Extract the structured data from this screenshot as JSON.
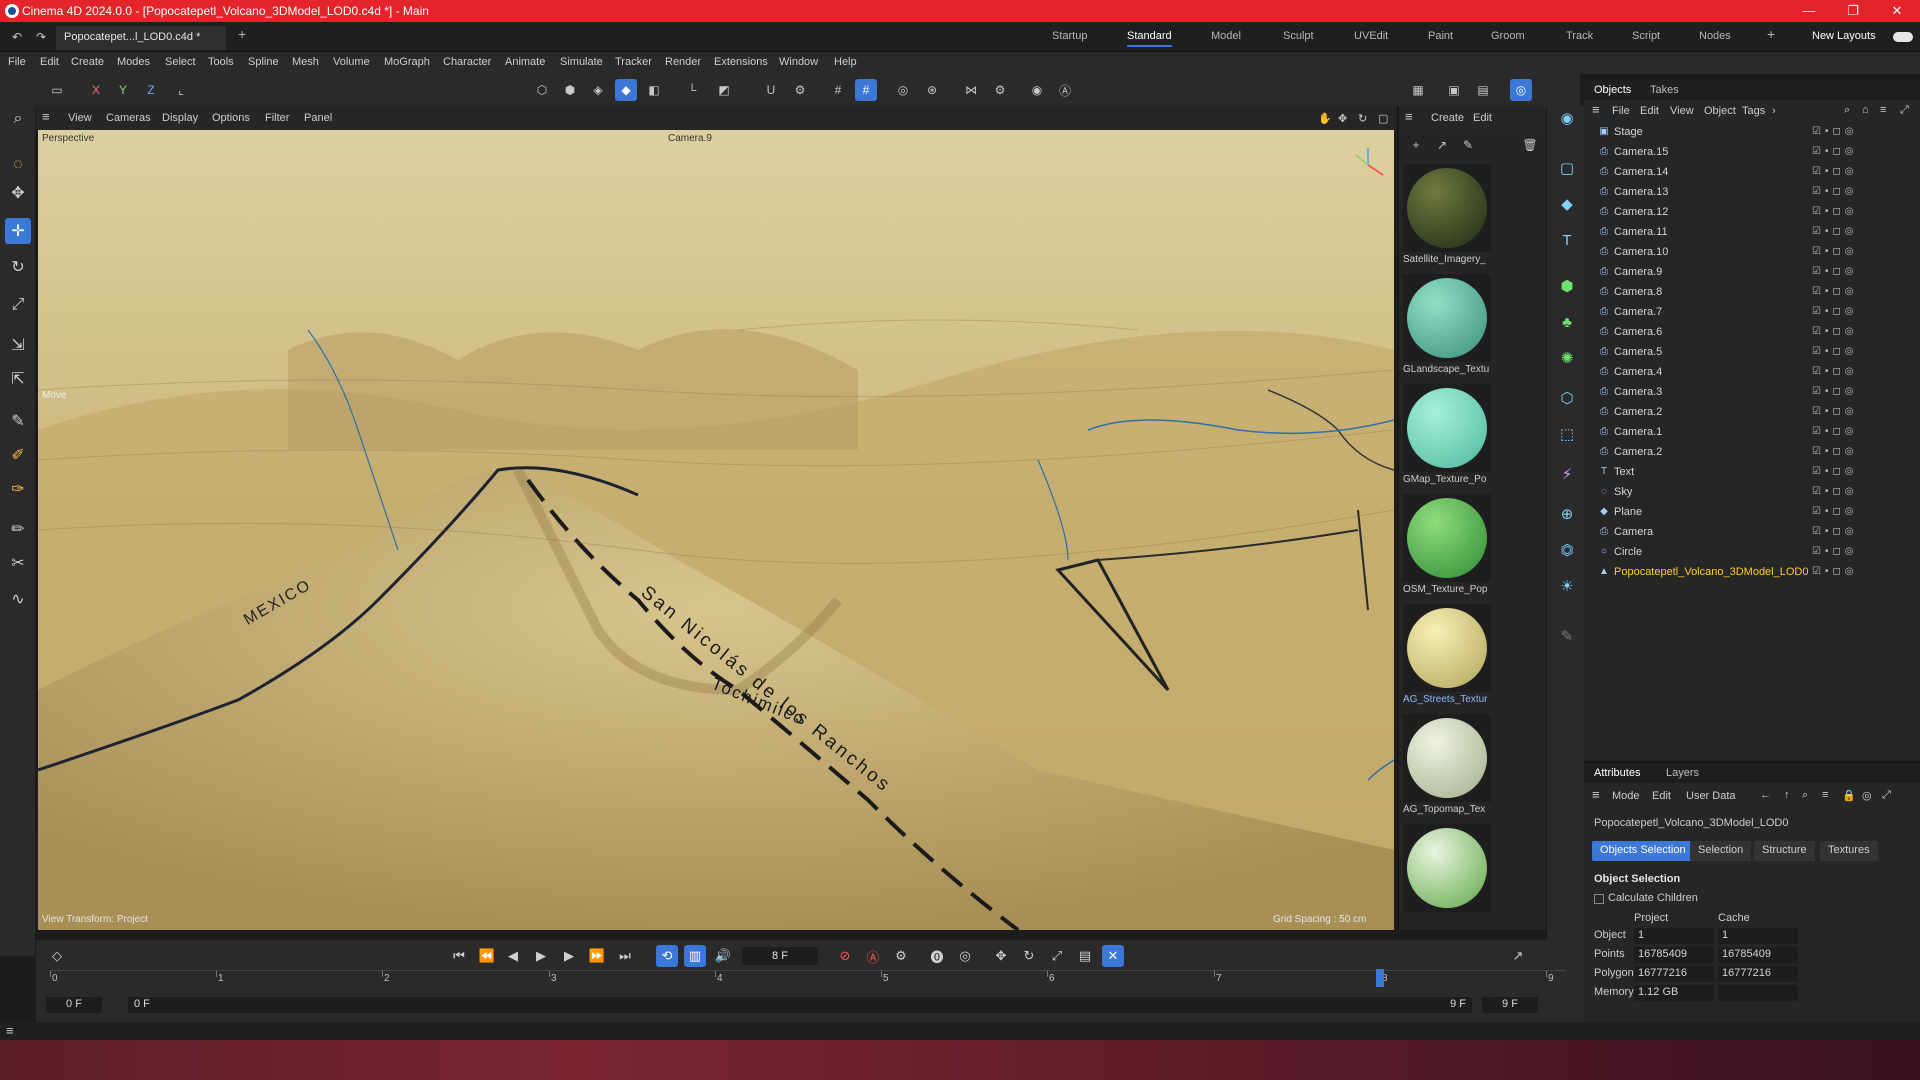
{
  "window": {
    "title": "Cinema 4D 2024.0.0 - [Popocatepetl_Volcano_3DModel_LOD0.c4d *] - Main",
    "minimize": "—",
    "restore": "❐",
    "close": "✕"
  },
  "tabs": {
    "document": "Popocatepet...l_LOD0.c4d *",
    "add": "+",
    "layouts": [
      "Startup",
      "Standard",
      "Model",
      "Sculpt",
      "UVEdit",
      "Paint",
      "Groom",
      "Track",
      "Script",
      "Nodes"
    ],
    "active_layout": "Standard",
    "new_layouts": "New Layouts"
  },
  "menu": [
    "File",
    "Edit",
    "Create",
    "Modes",
    "Select",
    "Tools",
    "Spline",
    "Mesh",
    "Volume",
    "MoGraph",
    "Character",
    "Animate",
    "Simulate",
    "Tracker",
    "Render",
    "Extensions",
    "Window",
    "Help"
  ],
  "toolbar": {
    "axes": [
      "X",
      "Y",
      "Z"
    ]
  },
  "viewport": {
    "menu": [
      "View",
      "Cameras",
      "Display",
      "Options",
      "Filter",
      "Panel"
    ],
    "projection": "Perspective",
    "camera": "Camera.9",
    "hud_move": "Move",
    "view_transform": "View Transform: Project",
    "grid_spacing": "Grid Spacing : 50 cm",
    "map_labels": {
      "country": "MEXICO",
      "town1": "San Nicolás de los Ranchos",
      "town2": "Tochimilco"
    }
  },
  "materials": {
    "menu": [
      "Create",
      "Edit"
    ],
    "items": [
      {
        "name": "Satellite_Imagery_",
        "color_a": "#6f7a3e",
        "color_b": "#1f2a17"
      },
      {
        "name": "GLandscape_Textu",
        "color_a": "#8ee0c6",
        "color_b": "#3d8f7b"
      },
      {
        "name": "GMap_Texture_Po",
        "color_a": "#a6f0d9",
        "color_b": "#4fb99f"
      },
      {
        "name": "OSM_Texture_Pop",
        "color_a": "#8fdc7c",
        "color_b": "#2f8b35"
      },
      {
        "name": "AG_Streets_Textur",
        "color_a": "#f6f0b4",
        "color_b": "#b4a35d"
      },
      {
        "name": "AG_Topomap_Tex",
        "color_a": "#eef3e0",
        "color_b": "#a3ad8d"
      },
      {
        "name": "",
        "color_a": "#e9f4df",
        "color_b": "#5ea747"
      }
    ],
    "selected_index": 4
  },
  "objects": {
    "tabs": [
      "Objects",
      "Takes"
    ],
    "menu": [
      "File",
      "Edit",
      "View",
      "Object",
      "Tags"
    ],
    "rows": [
      {
        "name": "Stage",
        "icon": "stage-icon"
      },
      {
        "name": "Camera.15",
        "icon": "camera-icon"
      },
      {
        "name": "Camera.14",
        "icon": "camera-icon"
      },
      {
        "name": "Camera.13",
        "icon": "camera-icon"
      },
      {
        "name": "Camera.12",
        "icon": "camera-icon"
      },
      {
        "name": "Camera.11",
        "icon": "camera-icon"
      },
      {
        "name": "Camera.10",
        "icon": "camera-icon"
      },
      {
        "name": "Camera.9",
        "icon": "camera-icon"
      },
      {
        "name": "Camera.8",
        "icon": "camera-icon"
      },
      {
        "name": "Camera.7",
        "icon": "camera-icon"
      },
      {
        "name": "Camera.6",
        "icon": "camera-icon"
      },
      {
        "name": "Camera.5",
        "icon": "camera-icon"
      },
      {
        "name": "Camera.4",
        "icon": "camera-icon"
      },
      {
        "name": "Camera.3",
        "icon": "camera-icon"
      },
      {
        "name": "Camera.2",
        "icon": "camera-icon"
      },
      {
        "name": "Camera.1",
        "icon": "camera-icon"
      },
      {
        "name": "Camera.2",
        "icon": "camera-icon"
      },
      {
        "name": "Text",
        "icon": "text-icon"
      },
      {
        "name": "Sky",
        "icon": "sky-icon"
      },
      {
        "name": "Plane",
        "icon": "plane-icon"
      },
      {
        "name": "Camera",
        "icon": "camera-icon"
      },
      {
        "name": "Circle",
        "icon": "circle-icon"
      },
      {
        "name": "Popocatepetl_Volcano_3DModel_LOD0",
        "icon": "polygon-object-icon"
      }
    ],
    "selected_index": 22
  },
  "attributes": {
    "tabs": [
      "Attributes",
      "Layers"
    ],
    "menu": [
      "Mode",
      "Edit",
      "User Data"
    ],
    "object_name": "Popocatepetl_Volcano_3DModel_LOD0",
    "subtabs": [
      "Objects Selection",
      "Selection",
      "Structure",
      "Textures"
    ],
    "active_subtab": "Objects Selection",
    "section_title": "Object Selection",
    "calculate_children": "Calculate Children",
    "col_project": "Project",
    "col_cache": "Cache",
    "rows": [
      {
        "label": "Object",
        "project": "1",
        "cache": "1"
      },
      {
        "label": "Points",
        "project": "16785409",
        "cache": "16785409"
      },
      {
        "label": "Polygons",
        "project": "16777216",
        "cache": "16777216"
      },
      {
        "label": "Memory",
        "project": "1.12 GB",
        "cache": ""
      }
    ]
  },
  "timeline": {
    "current_frame": "8 F",
    "ruler": [
      "0",
      "1",
      "2",
      "3",
      "4",
      "5",
      "6",
      "7",
      "8",
      "9"
    ],
    "playhead": 8,
    "start": "0 F",
    "range_start": "0 F",
    "range_end": "9 F",
    "end": "9 F"
  },
  "colors": {
    "accent": "#3c78d8",
    "titlebar": "#e3242b",
    "terrain": "#c8b276"
  }
}
